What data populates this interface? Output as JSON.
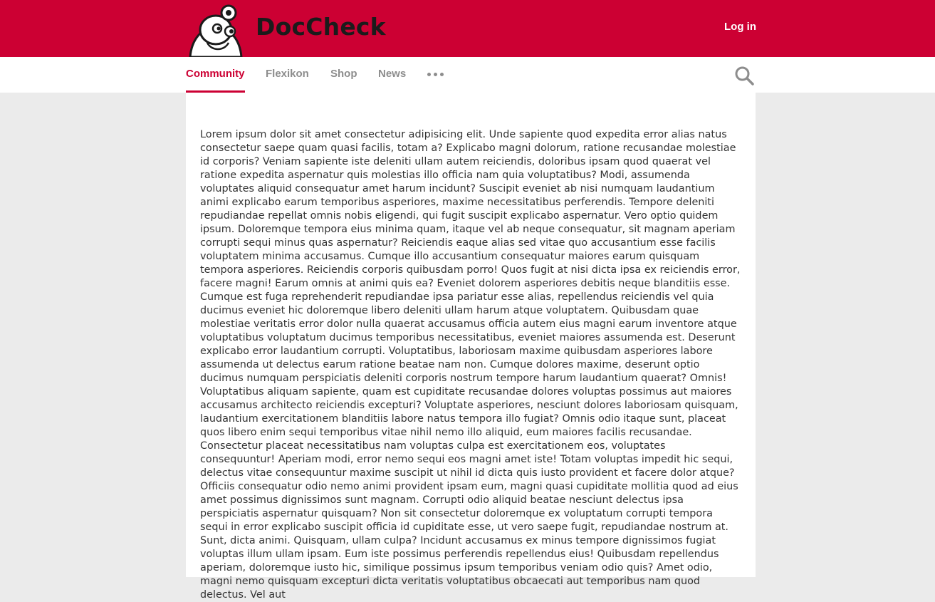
{
  "header": {
    "brand_name": "DocCheck",
    "login_label": "Log in",
    "logo_icon": "doccheck-mascot-icon",
    "brand_color": "#cc0033"
  },
  "nav": {
    "tabs": [
      {
        "label": "Community",
        "active": true
      },
      {
        "label": "Flexikon",
        "active": false
      },
      {
        "label": "Shop",
        "active": false
      },
      {
        "label": "News",
        "active": false
      }
    ],
    "more_icon": "more-dots-icon",
    "search_icon": "search-icon"
  },
  "content": {
    "body": "Lorem ipsum dolor sit amet consectetur adipisicing elit. Unde sapiente quod expedita error alias natus consectetur saepe quam quasi facilis, totam a? Explicabo magni dolorum, ratione recusandae molestiae id corporis? Veniam sapiente iste deleniti ullam autem reiciendis, doloribus ipsam quod quaerat vel ratione expedita aspernatur quis molestias illo officia nam quia voluptatibus? Modi, assumenda voluptates aliquid consequatur amet harum incidunt? Suscipit eveniet ab nisi numquam laudantium animi explicabo earum temporibus asperiores, maxime necessitatibus perferendis. Tempore deleniti repudiandae repellat omnis nobis eligendi, qui fugit suscipit explicabo aspernatur. Vero optio quidem ipsum. Doloremque tempora eius minima quam, itaque vel ab neque consequatur, sit magnam aperiam corrupti sequi minus quas aspernatur? Reiciendis eaque alias sed vitae quo accusantium esse facilis voluptatem minima accusamus. Cumque illo accusantium consequatur maiores earum quisquam tempora asperiores. Reiciendis corporis quibusdam porro! Quos fugit at nisi dicta ipsa ex reiciendis error, facere magni! Earum omnis at animi quis ea? Eveniet dolorem asperiores debitis neque blanditiis esse. Cumque est fuga reprehenderit repudiandae ipsa pariatur esse alias, repellendus reiciendis vel quia ducimus eveniet hic doloremque libero deleniti ullam harum atque voluptatem. Quibusdam quae molestiae veritatis error dolor nulla quaerat accusamus officia autem eius magni earum inventore atque voluptatibus voluptatum ducimus temporibus necessitatibus, eveniet maiores assumenda est. Deserunt explicabo error laudantium corrupti. Voluptatibus, laboriosam maxime quibusdam asperiores labore assumenda ut delectus earum ratione beatae nam non. Cumque dolores maxime, deserunt optio ducimus numquam perspiciatis deleniti corporis nostrum tempore harum laudantium quaerat? Omnis! Voluptatibus aliquam sapiente, quam est cupiditate recusandae dolores voluptas possimus aut maiores accusamus architecto reiciendis excepturi? Voluptate asperiores, nesciunt dolores laboriosam quisquam, laudantium exercitationem blanditiis labore natus tempora illo fugiat? Omnis odio itaque sunt, placeat quos libero enim sequi temporibus vitae nihil nemo illo aliquid, eum maiores facilis recusandae. Consectetur placeat necessitatibus nam voluptas culpa est exercitationem eos, voluptates consequuntur! Aperiam modi, error nemo sequi eos magni amet iste! Totam voluptas impedit hic sequi, delectus vitae consequuntur maxime suscipit ut nihil id dicta quis iusto provident et facere dolor atque? Officiis consequatur odio nemo animi provident ipsam eum, magni quasi cupiditate mollitia quod ad eius amet possimus dignissimos sunt magnam. Corrupti odio aliquid beatae nesciunt delectus ipsa perspiciatis aspernatur quisquam? Non sit consectetur doloremque ex voluptatum corrupti tempora sequi in error explicabo suscipit officia id cupiditate esse, ut vero saepe fugit, repudiandae nostrum at. Sunt, dicta animi. Quisquam, ullam culpa? Incidunt accusamus ex minus tempore dignissimos fugiat voluptas illum ullam ipsam. Eum iste possimus perferendis repellendus eius! Quibusdam repellendus aperiam, doloremque iusto hic, similique possimus ipsum temporibus veniam odio quis? Amet odio, magni nemo quisquam excepturi dicta veritatis voluptatibus obcaecati aut temporibus nam quod delectus. Vel aut"
  }
}
